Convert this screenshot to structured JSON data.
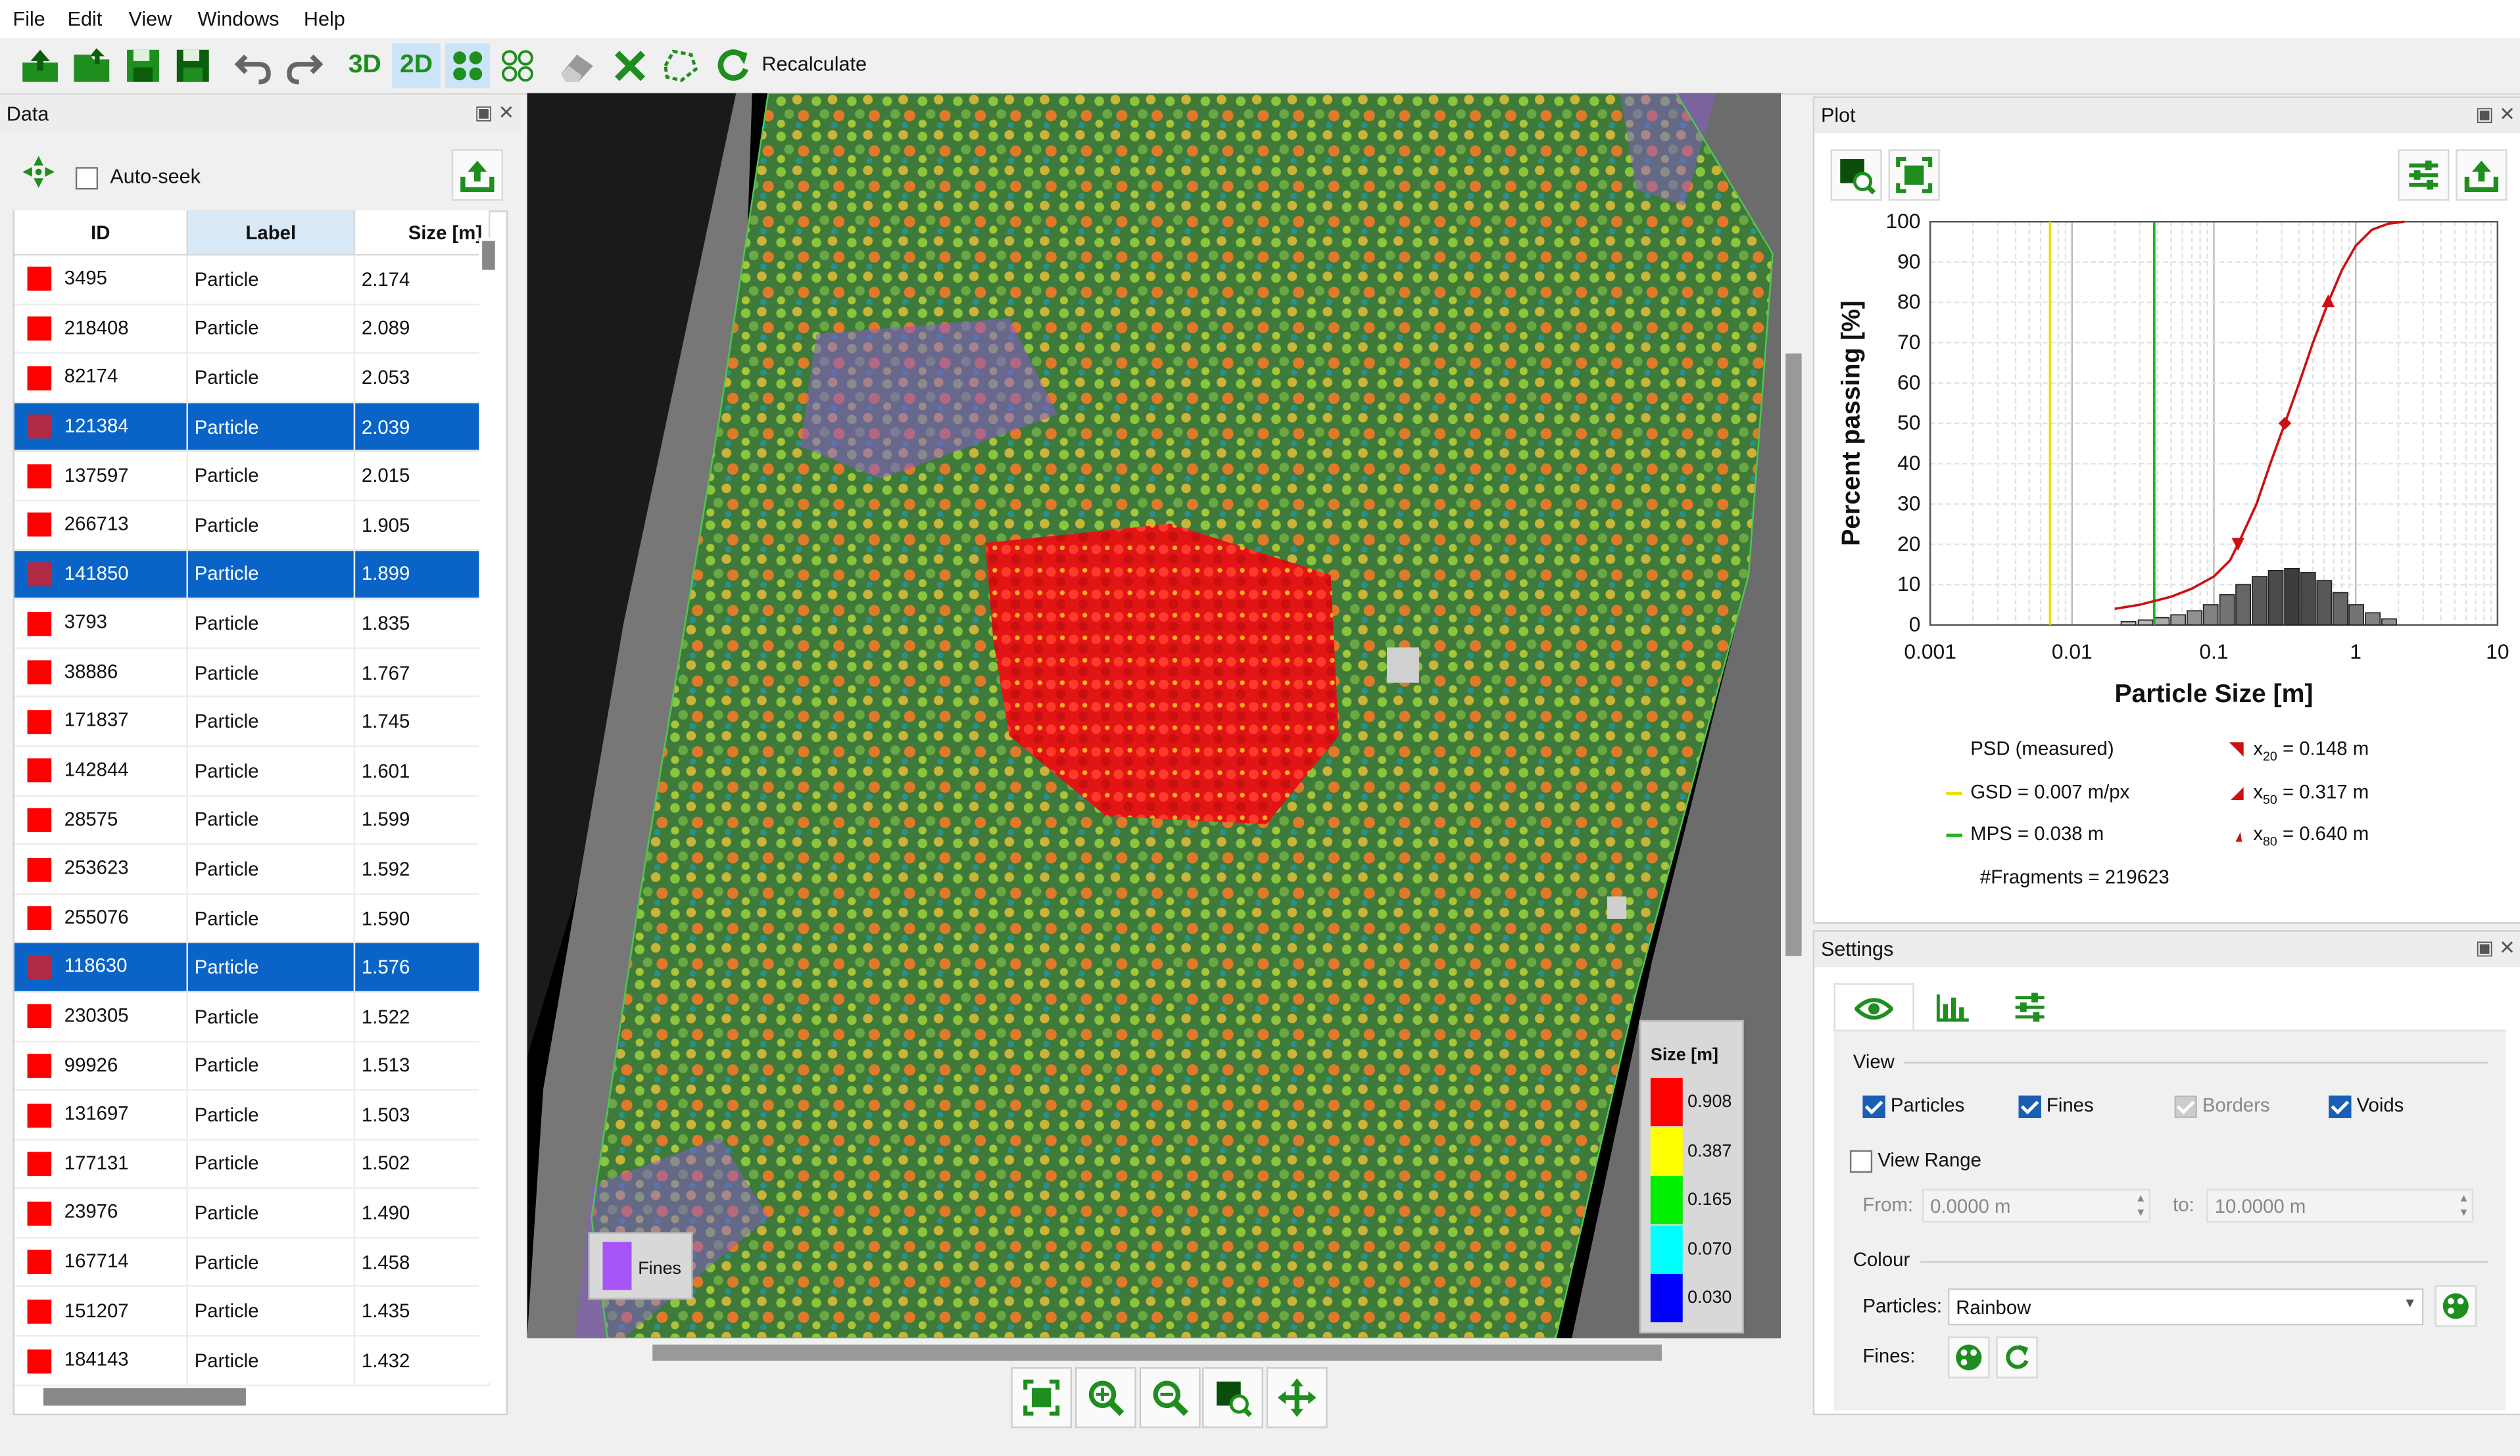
{
  "menu": [
    "File",
    "Edit",
    "View",
    "Windows",
    "Help"
  ],
  "toolbar": {
    "mode_3d": "3D",
    "mode_2d": "2D",
    "recalculate": "Recalculate"
  },
  "data_panel": {
    "title": "Data",
    "auto_seek": "Auto-seek",
    "columns": [
      "ID",
      "Label",
      "Size [m]"
    ],
    "rows": [
      {
        "id": "3495",
        "label": "Particle",
        "size": "2.174",
        "selected": false
      },
      {
        "id": "218408",
        "label": "Particle",
        "size": "2.089",
        "selected": false
      },
      {
        "id": "82174",
        "label": "Particle",
        "size": "2.053",
        "selected": false
      },
      {
        "id": "121384",
        "label": "Particle",
        "size": "2.039",
        "selected": true
      },
      {
        "id": "137597",
        "label": "Particle",
        "size": "2.015",
        "selected": false
      },
      {
        "id": "266713",
        "label": "Particle",
        "size": "1.905",
        "selected": false
      },
      {
        "id": "141850",
        "label": "Particle",
        "size": "1.899",
        "selected": true
      },
      {
        "id": "3793",
        "label": "Particle",
        "size": "1.835",
        "selected": false
      },
      {
        "id": "38886",
        "label": "Particle",
        "size": "1.767",
        "selected": false
      },
      {
        "id": "171837",
        "label": "Particle",
        "size": "1.745",
        "selected": false
      },
      {
        "id": "142844",
        "label": "Particle",
        "size": "1.601",
        "selected": false
      },
      {
        "id": "28575",
        "label": "Particle",
        "size": "1.599",
        "selected": false
      },
      {
        "id": "253623",
        "label": "Particle",
        "size": "1.592",
        "selected": false
      },
      {
        "id": "255076",
        "label": "Particle",
        "size": "1.590",
        "selected": false
      },
      {
        "id": "118630",
        "label": "Particle",
        "size": "1.576",
        "selected": true
      },
      {
        "id": "230305",
        "label": "Particle",
        "size": "1.522",
        "selected": false
      },
      {
        "id": "99926",
        "label": "Particle",
        "size": "1.513",
        "selected": false
      },
      {
        "id": "131697",
        "label": "Particle",
        "size": "1.503",
        "selected": false
      },
      {
        "id": "177131",
        "label": "Particle",
        "size": "1.502",
        "selected": false
      },
      {
        "id": "23976",
        "label": "Particle",
        "size": "1.490",
        "selected": false
      },
      {
        "id": "167714",
        "label": "Particle",
        "size": "1.458",
        "selected": false
      },
      {
        "id": "151207",
        "label": "Particle",
        "size": "1.435",
        "selected": false
      },
      {
        "id": "184143",
        "label": "Particle",
        "size": "1.432",
        "selected": false
      }
    ]
  },
  "viewer": {
    "legend_title": "Size [m]",
    "legend": [
      {
        "color": "#ff0000",
        "value": "0.908"
      },
      {
        "color": "#ffff00",
        "value": "0.387"
      },
      {
        "color": "#00ee00",
        "value": "0.165"
      },
      {
        "color": "#00ffff",
        "value": "0.070"
      },
      {
        "color": "#0000ff",
        "value": "0.030"
      }
    ],
    "fines_label": "Fines",
    "fines_color": "#a855f7"
  },
  "plot_panel": {
    "title": "Plot",
    "stats": {
      "psd": "PSD (measured)",
      "gsd": "GSD = 0.007 m/px",
      "mps": "MPS = 0.038 m",
      "fragments": "#Fragments = 219623",
      "x20": "= 0.148 m",
      "x50": "= 0.317 m",
      "x80": "= 0.640 m",
      "x20_sym": "x",
      "x20_sub": "20",
      "x50_sub": "50",
      "x80_sub": "80"
    }
  },
  "chart_data": {
    "type": "line",
    "xlabel": "Particle Size [m]",
    "ylabel": "Percent passing [%]",
    "xscale": "log",
    "xlim": [
      0.001,
      10
    ],
    "ylim": [
      0,
      100
    ],
    "x_ticks": [
      "0.001",
      "0.01",
      "0.1",
      "1",
      "10"
    ],
    "y_ticks": [
      "0",
      "10",
      "20",
      "30",
      "40",
      "50",
      "60",
      "70",
      "80",
      "90",
      "100"
    ],
    "grid": true,
    "series": [
      {
        "name": "PSD (measured)",
        "color": "#cc1111",
        "x": [
          0.02,
          0.03,
          0.05,
          0.07,
          0.1,
          0.13,
          0.148,
          0.2,
          0.25,
          0.317,
          0.4,
          0.5,
          0.64,
          0.8,
          1.0,
          1.3,
          1.7,
          2.2
        ],
        "y": [
          4,
          5,
          7,
          9,
          12,
          16,
          20,
          30,
          40,
          50,
          60,
          70,
          80,
          88,
          94,
          98,
          99.5,
          100
        ]
      }
    ],
    "vlines": [
      {
        "name": "GSD",
        "x": 0.007,
        "color": "#e8e000"
      },
      {
        "name": "MPS",
        "x": 0.038,
        "color": "#1fb31f"
      }
    ],
    "markers": [
      {
        "name": "x20",
        "x": 0.148,
        "y": 20
      },
      {
        "name": "x50",
        "x": 0.317,
        "y": 50
      },
      {
        "name": "x80",
        "x": 0.64,
        "y": 80
      }
    ],
    "histogram": {
      "x": [
        0.025,
        0.033,
        0.043,
        0.056,
        0.073,
        0.095,
        0.124,
        0.161,
        0.21,
        0.273,
        0.355,
        0.462,
        0.6,
        0.78,
        1.01,
        1.32,
        1.72
      ],
      "y": [
        0.8,
        1.2,
        1.8,
        2.5,
        3.5,
        5,
        7.5,
        10,
        12,
        13.5,
        14,
        13,
        11,
        8,
        5,
        3,
        1.5
      ]
    }
  },
  "settings_panel": {
    "title": "Settings",
    "view_header": "View",
    "particles": "Particles",
    "fines": "Fines",
    "borders": "Borders",
    "voids": "Voids",
    "view_range": "View Range",
    "from_label": "From:",
    "from_value": "0.0000 m",
    "to_label": "to:",
    "to_value": "10.0000 m",
    "colour_header": "Colour",
    "particles_label": "Particles:",
    "particles_colormap": "Rainbow",
    "fines_label": "Fines:"
  }
}
